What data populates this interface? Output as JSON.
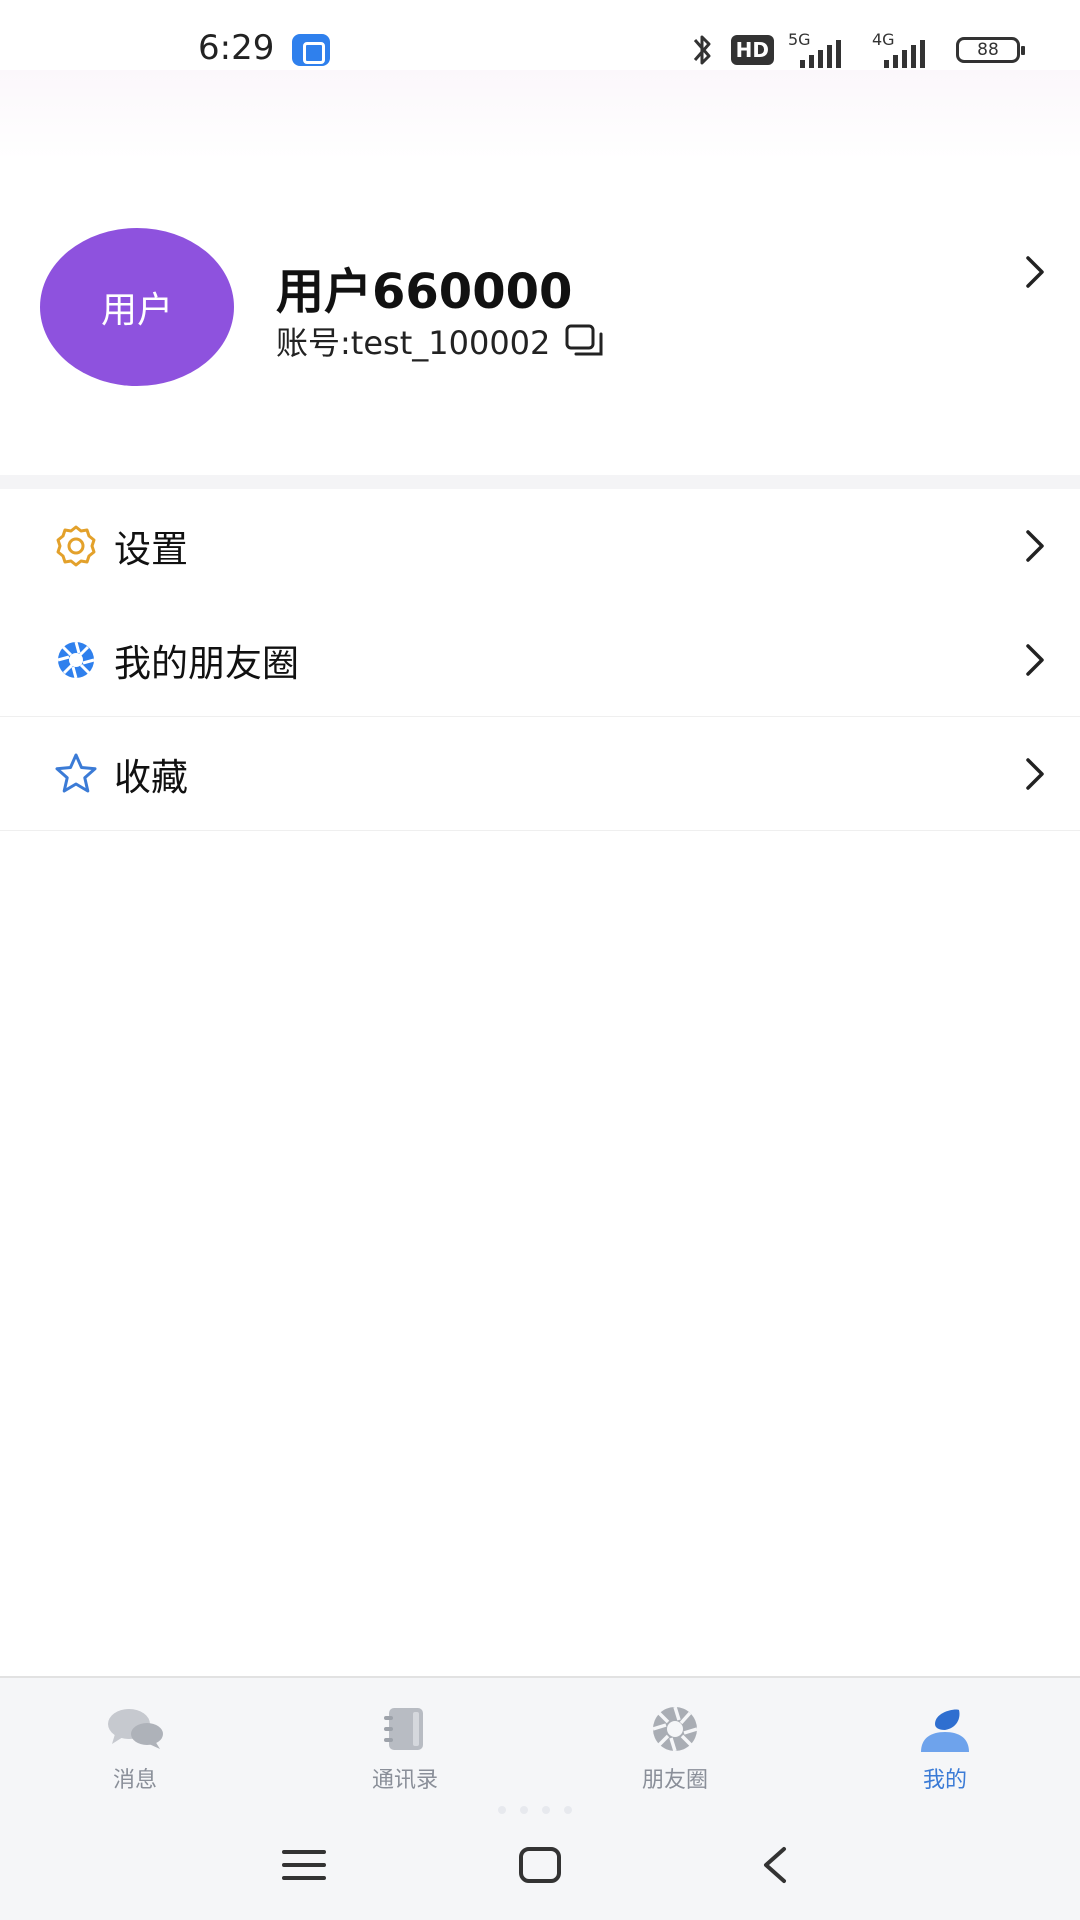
{
  "status_bar": {
    "time": "6:29",
    "hd_badge": "HD",
    "network_1": "5G",
    "network_2": "4G",
    "battery": "88",
    "icons": [
      "app-notification-icon",
      "bluetooth-icon",
      "signal-icon",
      "battery-icon"
    ]
  },
  "profile": {
    "avatar_text": "用户",
    "name": "用户660000",
    "account": "账号:test_100002",
    "avatar_color": "#8e52de"
  },
  "menu": {
    "items": [
      {
        "label": "设置",
        "icon": "gear-icon"
      },
      {
        "label": "我的朋友圈",
        "icon": "moments-icon"
      },
      {
        "label": "收藏",
        "icon": "star-icon"
      }
    ]
  },
  "tabs": {
    "items": [
      {
        "label": "消息",
        "icon": "chat-bubbles-icon"
      },
      {
        "label": "通讯录",
        "icon": "contacts-book-icon"
      },
      {
        "label": "朋友圈",
        "icon": "aperture-icon"
      },
      {
        "label": "我的",
        "icon": "person-icon",
        "active": true
      }
    ],
    "active_color": "#3b7bd6",
    "inactive_color": "#8a8f99"
  },
  "system_nav": {
    "icons": [
      "menu-icon",
      "home-icon",
      "back-icon"
    ]
  }
}
